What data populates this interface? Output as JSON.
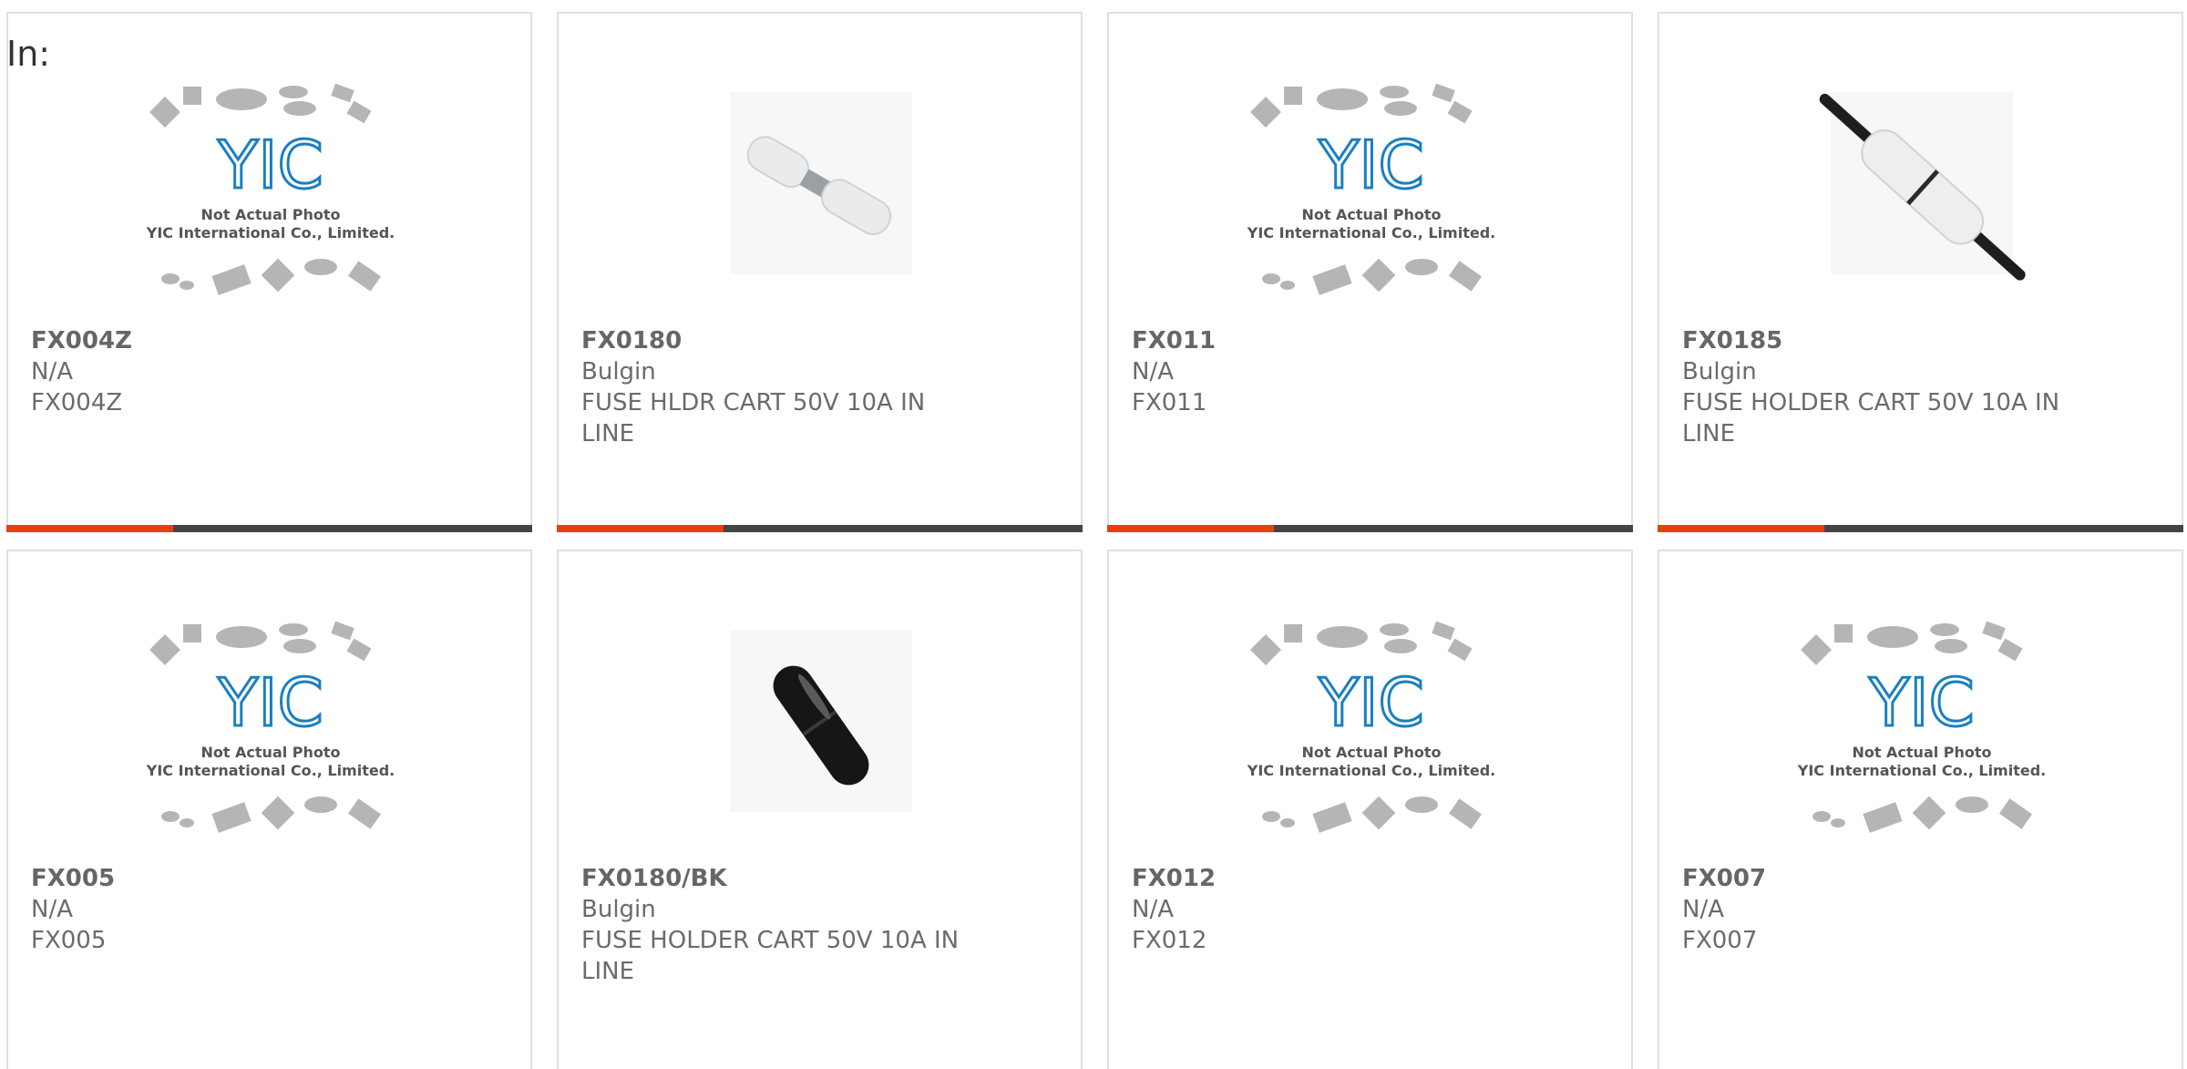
{
  "page": {
    "prefix_label": "In:"
  },
  "products": [
    {
      "part_number": "FX004Z",
      "manufacturer": "N/A",
      "description": "FX004Z",
      "image": "yic-placeholder"
    },
    {
      "part_number": "FX0180",
      "manufacturer": "Bulgin",
      "description": "FUSE HLDR CART 50V 10A IN LINE",
      "image": "clear-inline-fuse-holder"
    },
    {
      "part_number": "FX011",
      "manufacturer": "N/A",
      "description": "FX011",
      "image": "yic-placeholder"
    },
    {
      "part_number": "FX0185",
      "manufacturer": "Bulgin",
      "description": "FUSE HOLDER CART 50V 10A IN LINE",
      "image": "clear-inline-fuse-holder-wired"
    },
    {
      "part_number": "FX005",
      "manufacturer": "N/A",
      "description": "FX005",
      "image": "yic-placeholder"
    },
    {
      "part_number": "FX0180/BK",
      "manufacturer": "Bulgin",
      "description": "FUSE HOLDER CART 50V 10A IN LINE",
      "image": "black-inline-fuse-holder"
    },
    {
      "part_number": "FX012",
      "manufacturer": "N/A",
      "description": "FX012",
      "image": "yic-placeholder"
    },
    {
      "part_number": "FX007",
      "manufacturer": "N/A",
      "description": "FX007",
      "image": "yic-placeholder"
    }
  ],
  "placeholder": {
    "logo_text": "YIC",
    "line1": "Not Actual Photo",
    "line2": "YIC International Co., Limited."
  },
  "colors": {
    "accent_orange": "#e8400c",
    "accent_dark": "#444444",
    "text_gray": "#6b6b6b",
    "border": "#e0e0e0"
  }
}
